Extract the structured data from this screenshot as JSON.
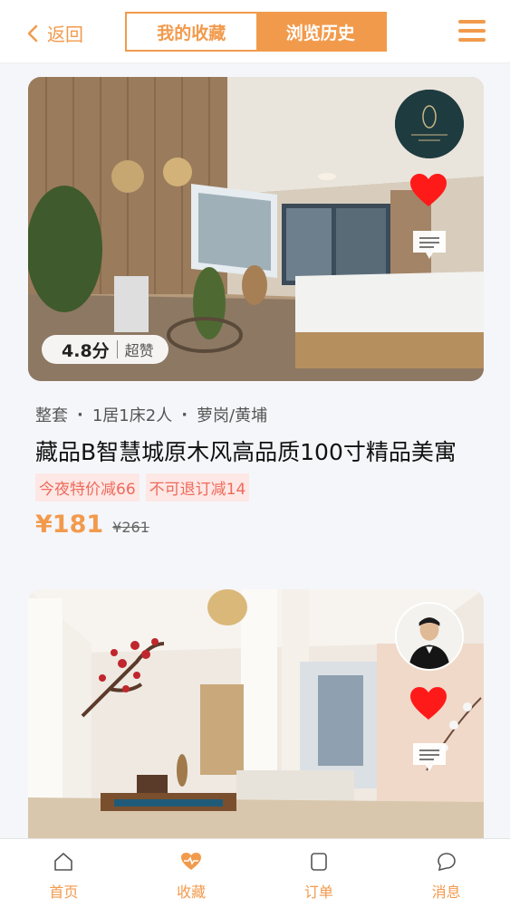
{
  "header": {
    "back_label": "返回",
    "tabs": [
      {
        "label": "我的收藏",
        "active": false
      },
      {
        "label": "浏览历史",
        "active": true
      }
    ]
  },
  "theme": {
    "accent": "#f29a4c",
    "tag_bg": "#fde8e6",
    "tag_text": "#ef6a5a",
    "heart": "#ff1a1a"
  },
  "listings": [
    {
      "rating_score": "4.8分",
      "rating_label": "超赞",
      "meta": [
        "整套",
        "1居1床2人",
        "萝岗/黄埔"
      ],
      "title": "藏品B智慧城原木风高品质100寸精品美寓",
      "tags": [
        "今夜特价减66",
        "不可退订减14"
      ],
      "price": "¥181",
      "original_price": "¥261",
      "favorited": true
    },
    {
      "favorited": true
    }
  ],
  "tabbar": [
    {
      "label": "首页",
      "icon": "home-icon"
    },
    {
      "label": "收藏",
      "icon": "heart-pulse-icon"
    },
    {
      "label": "订单",
      "icon": "order-icon"
    },
    {
      "label": "消息",
      "icon": "message-icon"
    }
  ]
}
